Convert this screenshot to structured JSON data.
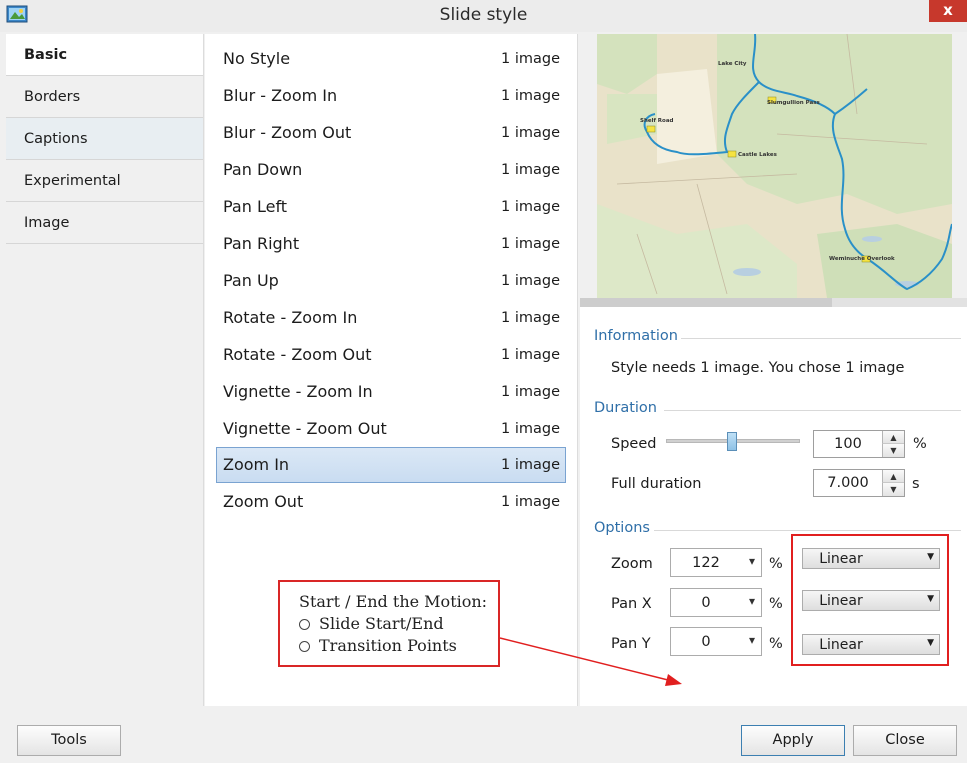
{
  "window": {
    "title": "Slide style",
    "close_glyph": "x"
  },
  "nav": {
    "items": [
      {
        "label": "Basic",
        "active": true
      },
      {
        "label": "Borders",
        "active": false
      },
      {
        "label": "Captions",
        "active": false
      },
      {
        "label": "Experimental",
        "active": false
      },
      {
        "label": "Image",
        "active": false
      }
    ]
  },
  "styles": {
    "selected_index": 11,
    "items": [
      {
        "name": "No Style",
        "count": "1 image"
      },
      {
        "name": "Blur - Zoom In",
        "count": "1 image"
      },
      {
        "name": "Blur - Zoom Out",
        "count": "1 image"
      },
      {
        "name": "Pan Down",
        "count": "1 image"
      },
      {
        "name": "Pan Left",
        "count": "1 image"
      },
      {
        "name": "Pan Right",
        "count": "1 image"
      },
      {
        "name": "Pan Up",
        "count": "1 image"
      },
      {
        "name": "Rotate - Zoom In",
        "count": "1 image"
      },
      {
        "name": "Rotate - Zoom Out",
        "count": "1 image"
      },
      {
        "name": "Vignette - Zoom In",
        "count": "1 image"
      },
      {
        "name": "Vignette - Zoom Out",
        "count": "1 image"
      },
      {
        "name": "Zoom In",
        "count": "1 image"
      },
      {
        "name": "Zoom Out",
        "count": "1 image"
      }
    ]
  },
  "preview": {
    "labels": [
      "Lake City",
      "Slumgullion Pass",
      "Shelf Road",
      "Castle Lakes",
      "Weminuche Overlook"
    ],
    "scroll_position": 0.65
  },
  "information": {
    "header": "Information",
    "text": "Style needs 1 image. You chose 1 image"
  },
  "duration": {
    "header": "Duration",
    "speed_label": "Speed",
    "speed_value": "100",
    "speed_unit": "%",
    "speed_slider_level": 0.5,
    "full_label": "Full duration",
    "full_value": "7.000",
    "full_unit": "s"
  },
  "options": {
    "header": "Options",
    "rows": [
      {
        "label": "Zoom",
        "value": "122",
        "unit": "%",
        "easing": "Linear"
      },
      {
        "label": "Pan X",
        "value": "0",
        "unit": "%",
        "easing": "Linear"
      },
      {
        "label": "Pan Y",
        "value": "0",
        "unit": "%",
        "easing": "Linear"
      }
    ]
  },
  "annotation": {
    "title": "Start / End the Motion:",
    "choices": [
      "Slide Start/End",
      "Transition Points"
    ]
  },
  "buttons": {
    "tools": "Tools",
    "apply": "Apply",
    "close": "Close"
  },
  "colors": {
    "accent": "#2f6fa8",
    "selection": "#c9dcf1",
    "annotation_red": "#e11f1f",
    "route_blue": "#2a90c8"
  }
}
